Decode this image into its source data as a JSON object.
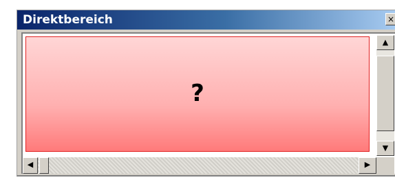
{
  "window": {
    "title": "Direktbereich",
    "close_glyph": "×"
  },
  "content": {
    "message": "?",
    "background_colors": [
      "#ffd6d6",
      "#ff7a7a"
    ],
    "border_color": "#e02020"
  },
  "scrollbars": {
    "up_arrow": "▲",
    "down_arrow": "▼",
    "left_arrow": "◀",
    "right_arrow": "▶"
  },
  "colors": {
    "titlebar_start": "#0a246a",
    "titlebar_end": "#a6caf0",
    "chrome": "#d4d0c8"
  }
}
